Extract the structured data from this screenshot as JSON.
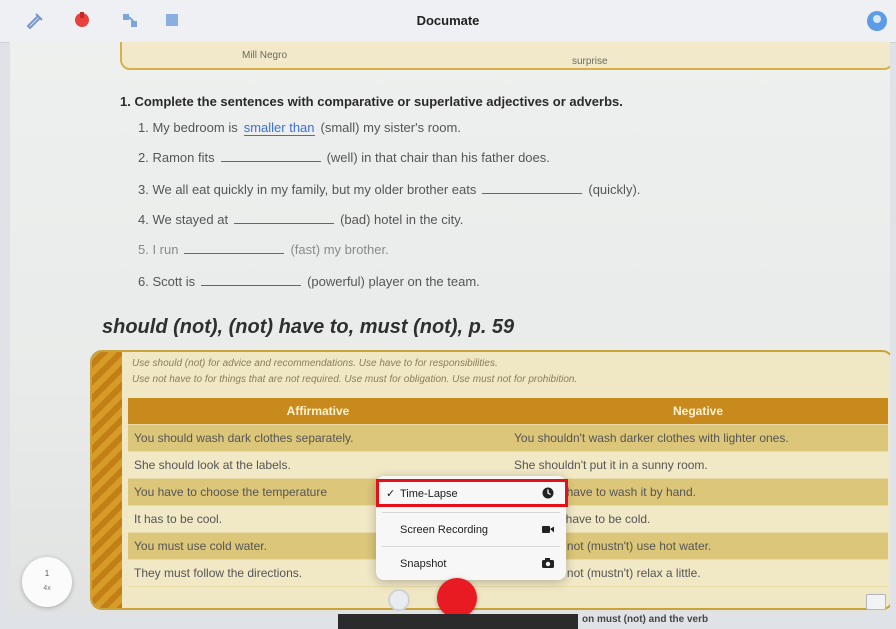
{
  "app": {
    "title": "Documate"
  },
  "colors": {
    "accent_red": "#e5101a",
    "record_red": "#e81b22",
    "table_header": "#c98a1d"
  },
  "toolbar": {
    "icons": [
      "pen-icon",
      "marker-icon",
      "connector-icon",
      "square-icon",
      "profile-icon"
    ]
  },
  "page": {
    "banner_left": "Mill Negro",
    "banner_right": "surprise",
    "question_heading": "1. Complete the sentences with comparative or superlative adjectives or adverbs.",
    "sentences": [
      {
        "before": "1. My bedroom is",
        "fill": "smaller than",
        "after": "(small) my sister's room."
      },
      {
        "before": "2. Ramon fits",
        "fill": "",
        "after": "(well) in that chair than his father does."
      },
      {
        "before": "3. We all eat quickly in my family, but my older brother eats",
        "fill": "",
        "after": "(quickly)."
      },
      {
        "before": "4. We stayed at",
        "fill": "",
        "after": "(bad) hotel in the city."
      },
      {
        "before": "5. I run",
        "fill": "",
        "after": "(fast) my brother."
      },
      {
        "before": "6. Scott is",
        "fill": "",
        "after": "(powerful) player on the team."
      }
    ],
    "section_title": "should (not), (not) have to, must (not), p. 59",
    "instructions": [
      "Use should (not) for advice and recommendations. Use have to for responsibilities.",
      "Use not have to for things that are not required. Use must for obligation. Use must not for prohibition."
    ],
    "table": {
      "headers": [
        "Affirmative",
        "Negative"
      ],
      "rows": [
        [
          "You should wash dark clothes separately.",
          "You shouldn't wash darker clothes with lighter ones."
        ],
        [
          "She should look at the labels.",
          "She shouldn't put it in a sunny room."
        ],
        [
          "You have to choose the temperature",
          "You don't have to wash it by hand."
        ],
        [
          "It has to be cool.",
          "It doesn't have to be cold."
        ],
        [
          "You must use cold water.",
          "You must not (mustn't) use hot water."
        ],
        [
          "They must follow the directions.",
          "You must not (mustn't) relax a little."
        ]
      ]
    }
  },
  "menu": {
    "items": [
      {
        "label": "Time-Lapse",
        "checked": true,
        "icon": "timelapse-icon"
      },
      {
        "label": "Screen Recording",
        "checked": false,
        "icon": "video-camera-icon"
      },
      {
        "label": "Snapshot",
        "checked": false,
        "icon": "camera-icon"
      }
    ],
    "checkmark": "✓"
  },
  "controls": {
    "zoom_top": "1",
    "zoom_bottom": "4x"
  },
  "bottom": {
    "text": "on must (not) and the verb"
  }
}
